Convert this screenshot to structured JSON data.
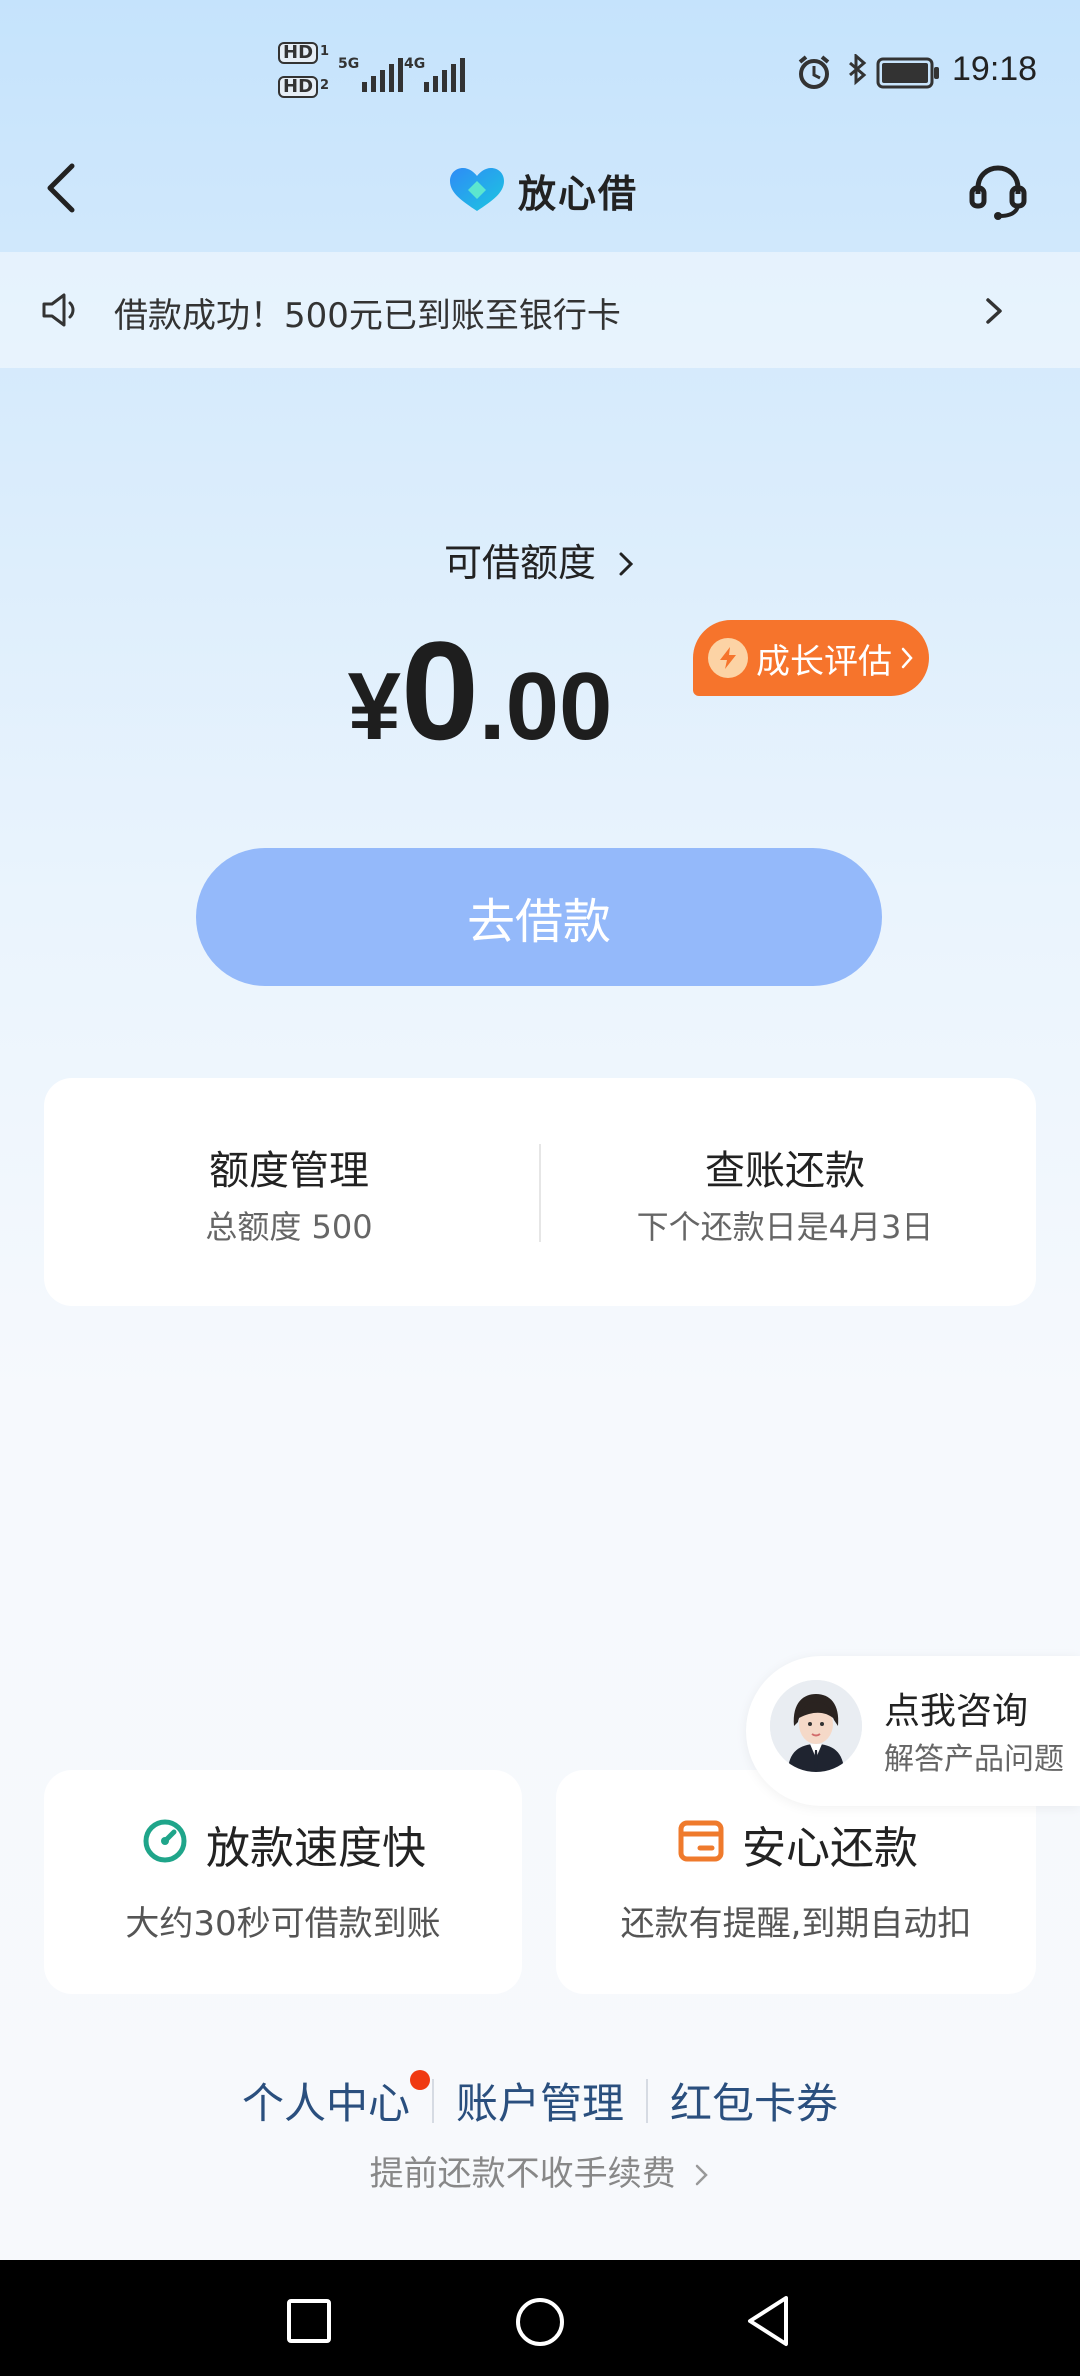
{
  "status_bar": {
    "time": "19:18",
    "sim1": "HD",
    "sim1_index": "1",
    "sim2": "HD",
    "sim2_index": "2",
    "network1": "5G",
    "network2": "4G"
  },
  "header": {
    "logo_text": "放心借"
  },
  "notice": {
    "text": "借款成功！500元已到账至银行卡"
  },
  "quota": {
    "label": "可借额度",
    "currency": "¥",
    "amount_int": "0",
    "amount_dec": ".00",
    "badge": "成长评估"
  },
  "borrow_button": "去借款",
  "quick_cards": [
    {
      "title": "额度管理",
      "subtitle": "总额度 500"
    },
    {
      "title": "查账还款",
      "subtitle": "下个还款日是4月3日"
    }
  ],
  "consult": {
    "title": "点我咨询",
    "subtitle": "解答产品问题"
  },
  "features": [
    {
      "title": "放款速度快",
      "subtitle": "大约30秒可借款到账",
      "icon": "speedometer-icon",
      "color": "#1fa58a"
    },
    {
      "title": "安心还款",
      "subtitle": "还款有提醒,到期自动扣",
      "icon": "wallet-icon",
      "color": "#ef7a2c"
    }
  ],
  "bottom_links": [
    "个人中心",
    "账户管理",
    "红包卡券"
  ],
  "prepay_text": "提前还款不收手续费",
  "colors": {
    "accent_button": "#94b9fa",
    "badge": "#f6742c",
    "link": "#2a4f7e",
    "red_dot": "#f03a12"
  }
}
